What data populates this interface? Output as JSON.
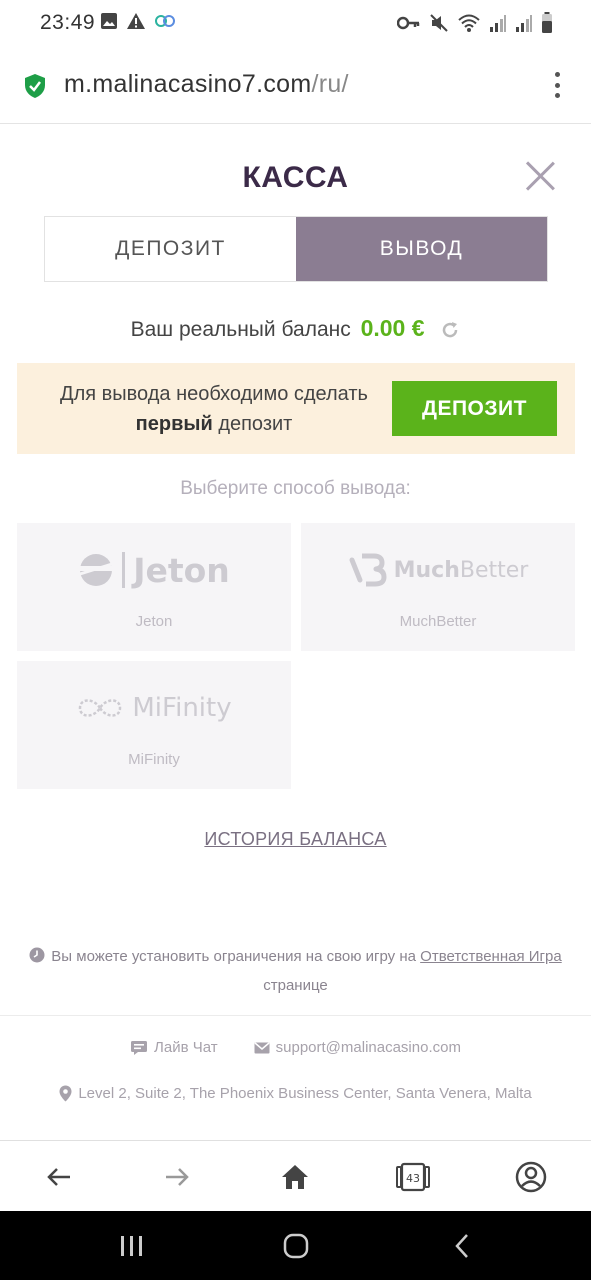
{
  "status_bar": {
    "time": "23:49",
    "left_icons": [
      "image-icon",
      "warning-icon",
      "link-icon"
    ],
    "right_icons": [
      "key-icon",
      "mute-icon",
      "wifi-icon",
      "signal-icon",
      "signal-r-icon",
      "battery-icon"
    ]
  },
  "url_bar": {
    "domain": "m.malinacasino7.com",
    "path": "/ru/"
  },
  "cashier": {
    "title": "КАССА",
    "tabs": [
      {
        "label": "ДЕПОЗИТ",
        "active": false
      },
      {
        "label": "ВЫВОД",
        "active": true
      }
    ],
    "balance_label": "Ваш реальный баланс",
    "balance_value": "0.00 €",
    "notice_line1": "Для вывода необходимо сделать",
    "notice_bold": "первый",
    "notice_line2": "депозит",
    "notice_button": "ДЕПОЗИТ",
    "choose_label": "Выберите способ вывода:",
    "methods": [
      {
        "logo_text": "Jeton",
        "label": "Jeton"
      },
      {
        "logo_text_1": "Much",
        "logo_text_2": "Better",
        "label": "MuchBetter"
      },
      {
        "logo_text": "MiFinity",
        "label": "MiFinity"
      }
    ],
    "history_link": "ИСТОРИЯ БАЛАНСА"
  },
  "footer": {
    "responsible_prefix": "Вы можете установить ограничения на свою игру на",
    "responsible_link": "Ответственная Игра",
    "responsible_suffix": "странице",
    "live_chat": "Лайв Чат",
    "email": "support@malinacasino.com",
    "address": "Level 2, Suite 2, The Phoenix Business Center, Santa Venera, Malta"
  },
  "browser_toolbar": {
    "tab_count": "43"
  },
  "colors": {
    "accent_green": "#5bb31b",
    "tab_active": "#8b7d92",
    "title": "#3b2a48",
    "notice_bg": "#fcf0dd"
  }
}
